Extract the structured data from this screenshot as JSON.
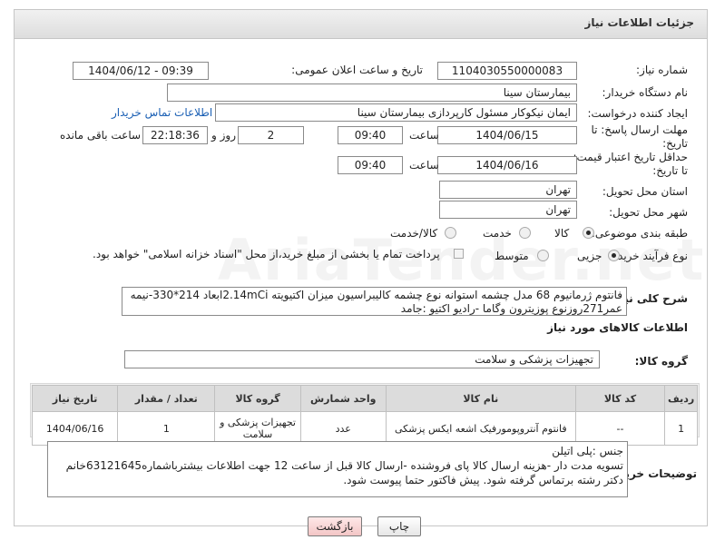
{
  "header": {
    "title": "جزئیات اطلاعات نیاز"
  },
  "form": {
    "need_number_label": "شماره نیاز:",
    "need_number": "1104030550000083",
    "announce_label": "تاریخ و ساعت اعلان عمومی:",
    "announce_value": "1404/06/12 - 09:39",
    "buyer_org_label": "نام دستگاه خریدار:",
    "buyer_org": "بیمارستان سینا",
    "creator_label": "ایجاد کننده درخواست:",
    "creator": "ایمان نیکوکار مسئول کارپردازی  بیمارستان سینا",
    "contact_link": "اطلاعات تماس خریدار",
    "deadline_label_1": "مهلت ارسال پاسخ: تا",
    "deadline_label_2": "تاریخ:",
    "deadline_date": "1404/06/15",
    "time_label": "ساعت",
    "deadline_time": "09:40",
    "days_value": "2",
    "days_label": "روز و",
    "remaining_time": "22:18:36",
    "remaining_label": "ساعت باقی مانده",
    "validity_label_1": "حداقل تاریخ اعتبار قیمت:",
    "validity_label_2": "تا تاریخ:",
    "validity_date": "1404/06/16",
    "validity_time": "09:40",
    "province_label": "استان محل تحویل:",
    "province": "تهران",
    "city_label": "شهر محل تحویل:",
    "city": "تهران",
    "category_label": "طبقه بندی موضوعی:",
    "category_options": [
      "کالا",
      "خدمت",
      "کالا/خدمت"
    ],
    "category_selected": "کالا",
    "process_label": "نوع فرآیند خرید :",
    "process_options": [
      "جزیی",
      "متوسط"
    ],
    "process_selected": "جزیی",
    "treasury_note": "پرداخت تمام یا بخشی از مبلغ خرید،از محل \"اسناد خزانه اسلامی\" خواهد بود.",
    "summary_label": "شرح کلی نیاز:",
    "summary_line1": "فانتوم ژرمانیوم 68 مدل چشمه استوانه نوع چشمه کالیبراسیون میزان اکتیویته 2.14mCiابعاد 214*330-نیمه",
    "summary_line2": "عمر271روزنوع پوزیترون وگاما -رادیو اکتیو :جامد"
  },
  "goods": {
    "section_title": "اطلاعات کالاهای مورد نیاز",
    "group_label": "گروه کالا:",
    "group_value": "تجهیزات پزشکی و سلامت",
    "columns": [
      "ردیف",
      "کد کالا",
      "نام کالا",
      "واحد شمارش",
      "گروه کالا",
      "تعداد / مقدار",
      "تاریخ نیاز"
    ],
    "rows": [
      {
        "row": "1",
        "code": "--",
        "name": "فانتوم آنتروپومورفیک اشعه ایکس پزشکی",
        "unit": "عدد",
        "group": "تجهیزات پزشکی و سلامت",
        "qty": "1",
        "date": "1404/06/16"
      }
    ]
  },
  "notes": {
    "label": "توضیحات خریدار:",
    "line1": "جنس :پلی اتیلن",
    "line2": "تسویه مدت دار -هزینه ارسال کالا پای فروشنده -ارسال کالا قبل از ساعت 12 جهت اطلاعات بیشترباشماره63121645خانم",
    "line3": "دکتر رشته برتماس گرفته شود. پیش فاکتور حتما پیوست شود."
  },
  "buttons": {
    "print": "چاپ",
    "back": "بازگشت"
  },
  "watermark": "AriaTender.net"
}
